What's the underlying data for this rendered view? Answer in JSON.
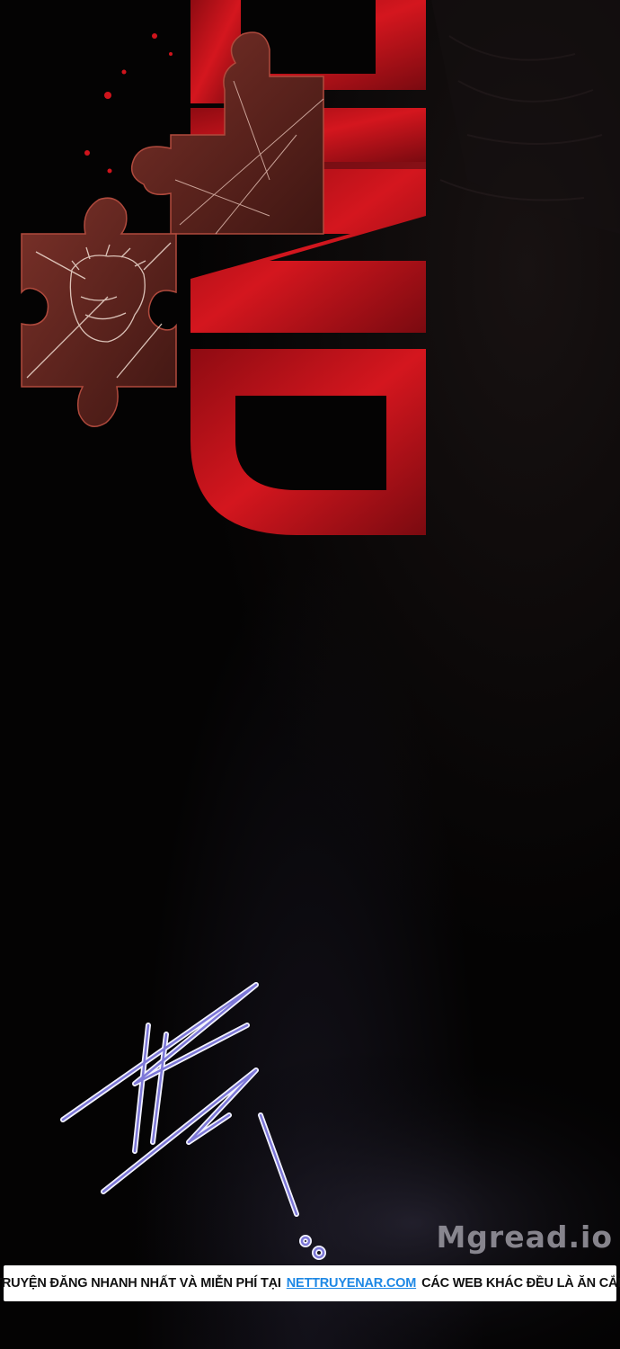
{
  "art": {
    "end_text": "END",
    "scribble_marks": "scribble-sound-effect"
  },
  "watermark": {
    "text": "Mgread.io"
  },
  "banner": {
    "before": "TRUYỆN ĐĂNG NHANH NHẤT VÀ MIỄN PHÍ TẠI",
    "site": "NETTRUYENAR.COM",
    "after": "CÁC WEB KHÁC ĐỀU LÀ ĂN CẮP"
  },
  "colors": {
    "background": "#040303",
    "end_red": "#c0121a",
    "puzzle": "#6a2620",
    "scribble": "#8a86e0",
    "banner_link": "#1e88e5"
  }
}
